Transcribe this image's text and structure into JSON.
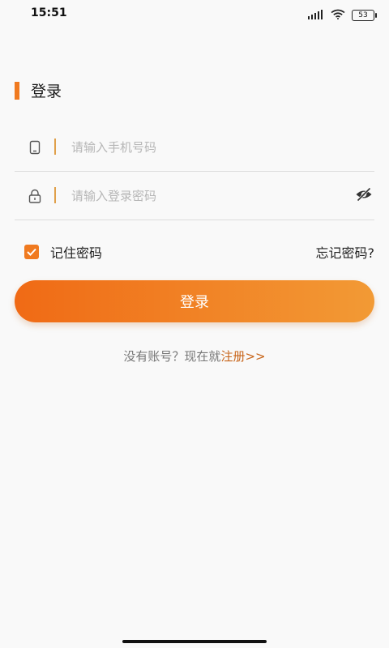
{
  "status_bar": {
    "time": "15:51",
    "battery": "53",
    "icons": [
      "signal-icon",
      "wifi-icon",
      "battery-icon"
    ]
  },
  "page": {
    "title": "登录"
  },
  "form": {
    "phone_placeholder": "请输入手机号码",
    "password_placeholder": "请输入登录密码",
    "remember_label": "记住密码",
    "remember_checked": true,
    "forgot_label": "忘记密码?",
    "login_button": "登录"
  },
  "register": {
    "prompt": "没有账号？现在就",
    "link": "注册>>"
  },
  "colors": {
    "accent": "#f07a20",
    "gradient_start": "#f06a15",
    "gradient_end": "#f29a35",
    "link": "#c8651a"
  }
}
